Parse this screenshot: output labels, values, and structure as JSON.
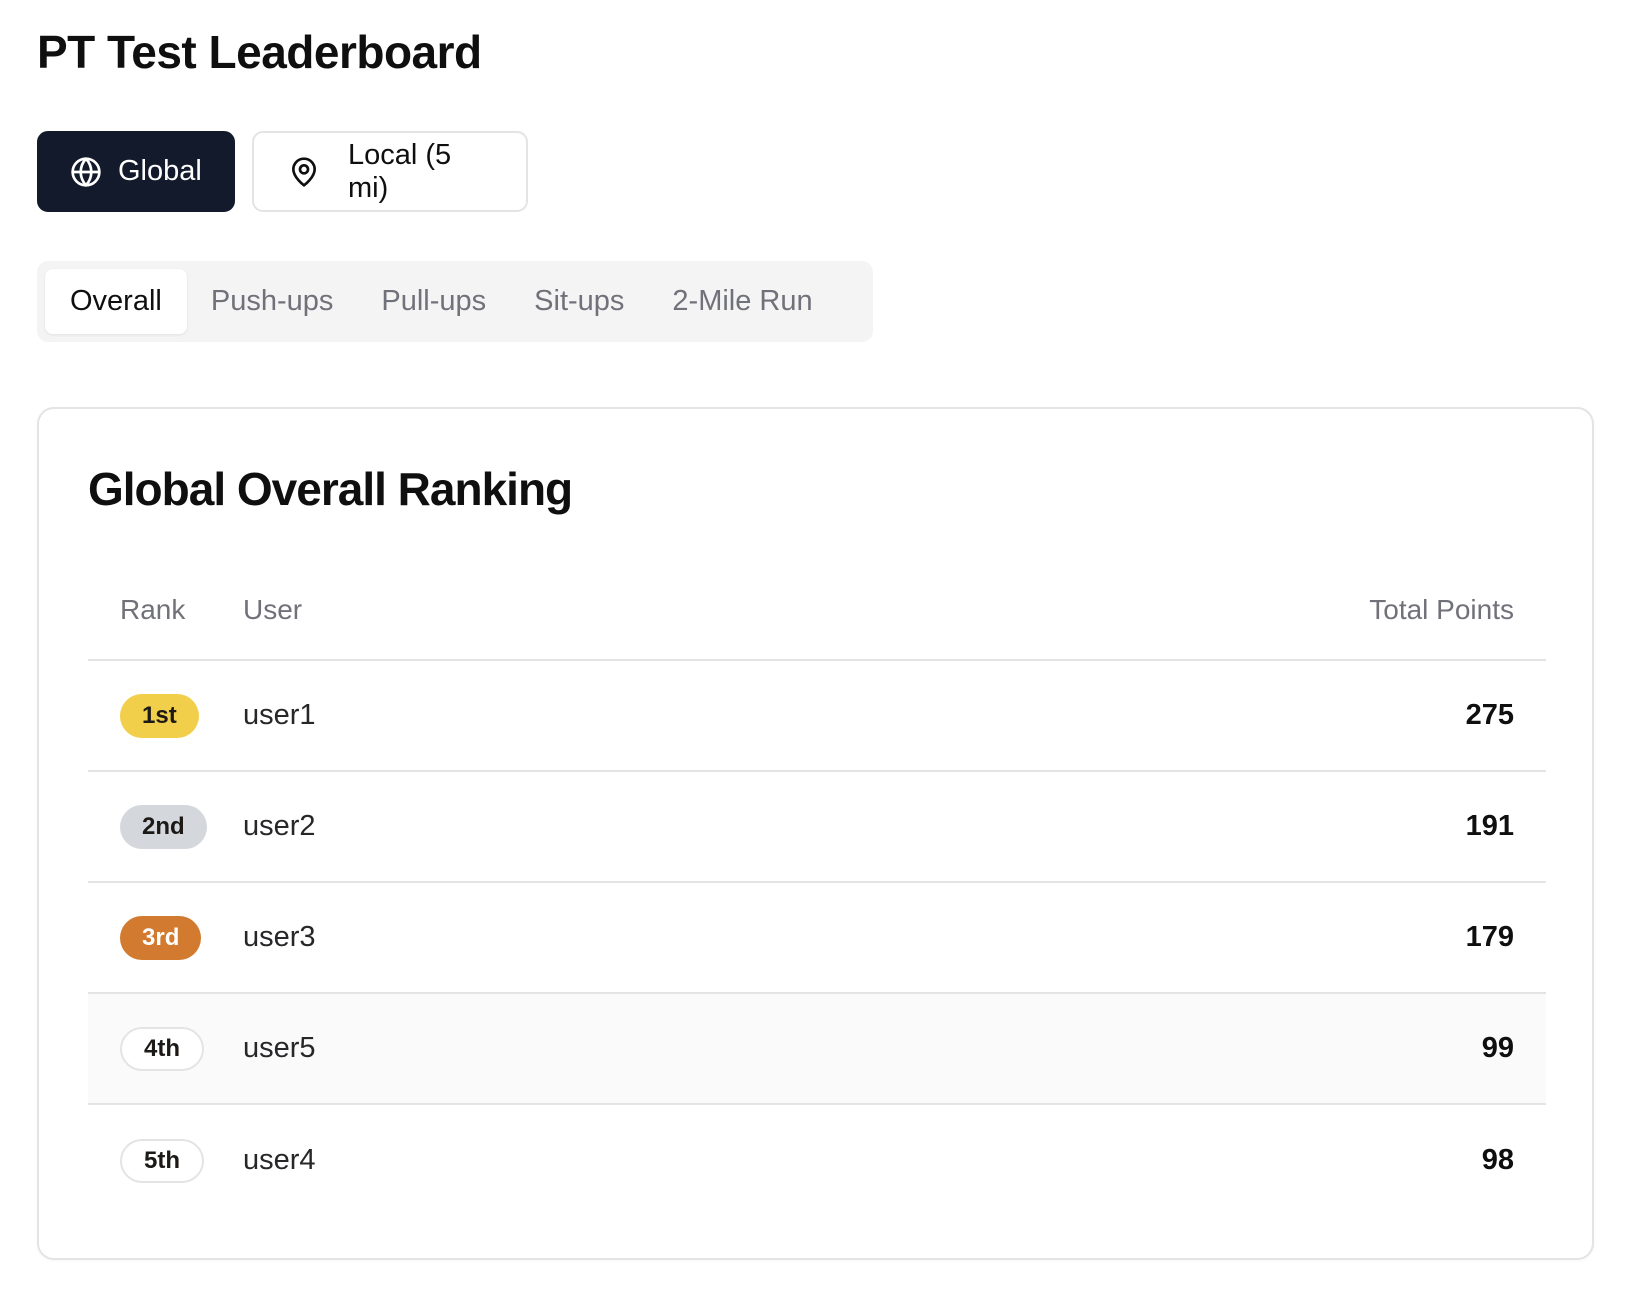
{
  "header": {
    "title": "PT Test Leaderboard"
  },
  "scope": {
    "global_label": "Global",
    "local_label": "Local (5 mi)",
    "global_icon": "globe-icon",
    "local_icon": "map-pin-icon",
    "active": "Global"
  },
  "tabs": [
    {
      "label": "Overall",
      "active": true
    },
    {
      "label": "Push-ups",
      "active": false
    },
    {
      "label": "Pull-ups",
      "active": false
    },
    {
      "label": "Sit-ups",
      "active": false
    },
    {
      "label": "2-Mile Run",
      "active": false
    }
  ],
  "ranking": {
    "title": "Global Overall Ranking",
    "columns": {
      "rank": "Rank",
      "user": "User",
      "points": "Total Points"
    },
    "rows": [
      {
        "rank": "1st",
        "user": "user1",
        "points": "275",
        "badge_color": "#f2cf4a"
      },
      {
        "rank": "2nd",
        "user": "user2",
        "points": "191",
        "badge_color": "#d4d7dc"
      },
      {
        "rank": "3rd",
        "user": "user3",
        "points": "179",
        "badge_color": "#d27a2f"
      },
      {
        "rank": "4th",
        "user": "user5",
        "points": "99",
        "badge_color": "#ffffff"
      },
      {
        "rank": "5th",
        "user": "user4",
        "points": "98",
        "badge_color": "#ffffff"
      }
    ]
  },
  "colors": {
    "primary": "#121a2b",
    "border": "#e4e4e7",
    "muted_text": "#71717a"
  }
}
